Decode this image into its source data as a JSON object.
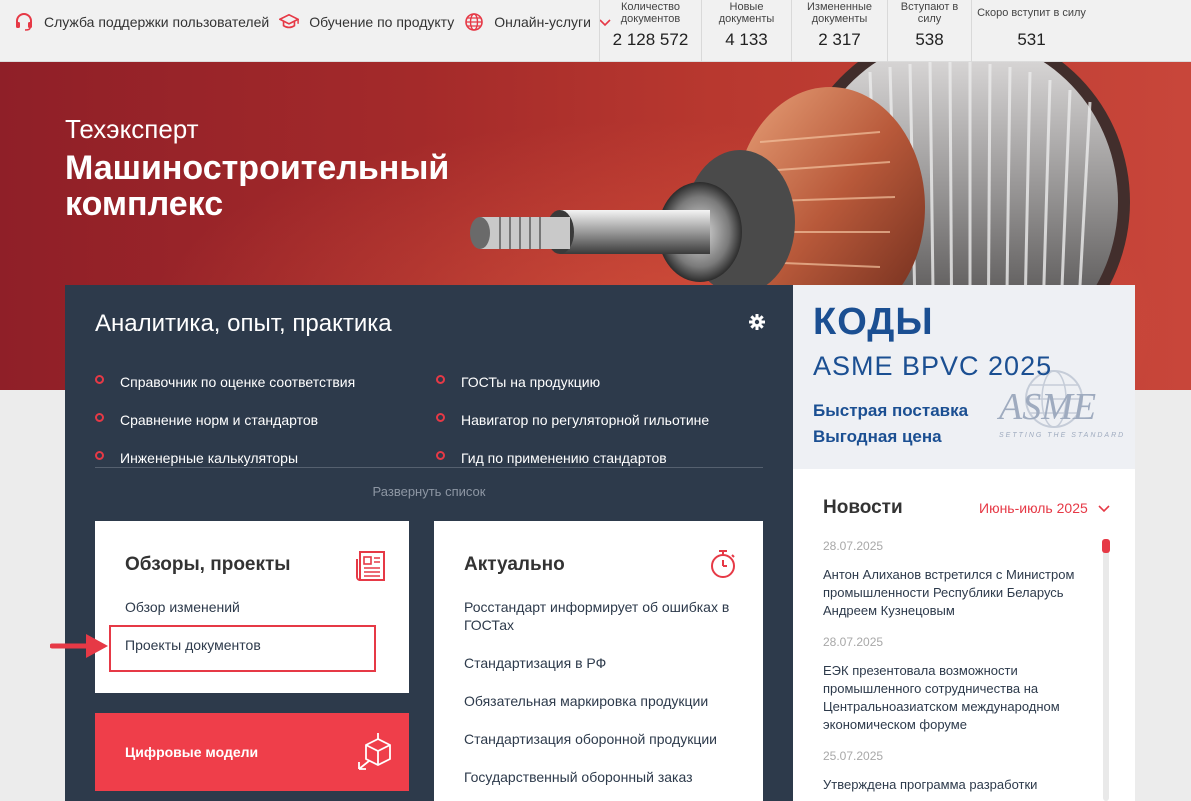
{
  "topbar": {
    "links": [
      {
        "label": "Служба поддержки пользователей",
        "icon": "headset-icon"
      },
      {
        "label": "Обучение по продукту",
        "icon": "graduation-cap-icon"
      },
      {
        "label": "Онлайн-услуги",
        "icon": "globe-icon"
      }
    ],
    "stats": [
      {
        "label": "Количество документов",
        "value": "2 128 572"
      },
      {
        "label": "Новые документы",
        "value": "4 133"
      },
      {
        "label": "Измененные документы",
        "value": "2 317"
      },
      {
        "label": "Вступают в силу",
        "value": "538"
      },
      {
        "label": "Скоро вступит в силу",
        "value": "531"
      }
    ]
  },
  "hero": {
    "brand": "Техэксперт",
    "title": "Машиностроительный комплекс"
  },
  "panel": {
    "title": "Аналитика, опыт, практика",
    "links_left": [
      "Справочник по оценке соответствия",
      "Сравнение норм и стандартов",
      "Инженерные калькуляторы"
    ],
    "links_right": [
      "ГОСТы на продукцию",
      "Навигатор по регуляторной гильотине",
      "Гид по применению стандартов"
    ],
    "expand": "Развернуть список",
    "reviews": {
      "title": "Обзоры, проекты",
      "links": [
        "Обзор изменений",
        "Проекты документов"
      ]
    },
    "actual": {
      "title": "Актуально",
      "links": [
        "Росстандарт информирует об ошибках в ГОСТах",
        "Стандартизация в РФ",
        "Обязательная маркировка продукции",
        "Стандартизация оборонной продукции",
        "Государственный оборонный заказ"
      ]
    },
    "digital": {
      "label": "Цифровые модели"
    }
  },
  "ad": {
    "line1": "КОДЫ",
    "line2": "ASME BPVC 2025",
    "line3": "Быстрая поставка",
    "line4": "Выгодная цена",
    "logo_text": "ASME",
    "logo_sub": "SETTING THE STANDARD"
  },
  "news": {
    "title": "Новости",
    "period": "Июнь-июль 2025",
    "items": [
      {
        "date": "28.07.2025",
        "text": "Антон Алиханов встретился с Министром промышленности Республики Беларусь Андреем Кузнецовым"
      },
      {
        "date": "28.07.2025",
        "text": "ЕЭК презентовала возможности промышленного сотрудничества на Центральноазиатском международном экономическом форуме"
      },
      {
        "date": "25.07.2025",
        "text": "Утверждена программа разработки"
      }
    ]
  },
  "colors": {
    "accent": "#e63946",
    "panel": "#2d3a4b",
    "brand_blue": "#1b4f92"
  }
}
